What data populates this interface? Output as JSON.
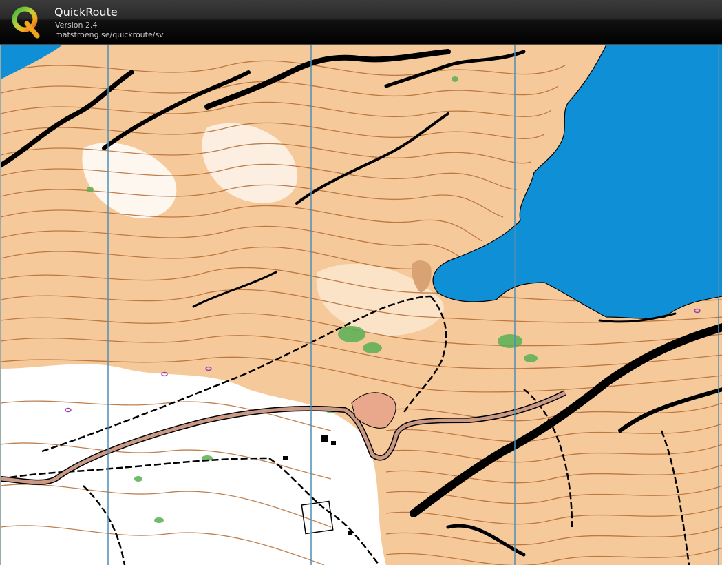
{
  "app": {
    "title": "QuickRoute",
    "version": "Version 2.4",
    "url": "matstroeng.se/quickroute/sv",
    "logo_letter": "Q"
  },
  "map": {
    "colors": {
      "terrain": "#f6c99a",
      "terrain_dark": "#f0b77f",
      "open_white": "#ffffff",
      "contour": "#b46a32",
      "water": "#0f8fd6",
      "rock": "#000000",
      "vegetation": "#59b055",
      "road": "#c99985",
      "building_area": "#e9a88b",
      "magnetic_north": "#4d8fb6",
      "marker": "#9b3bb0"
    }
  }
}
